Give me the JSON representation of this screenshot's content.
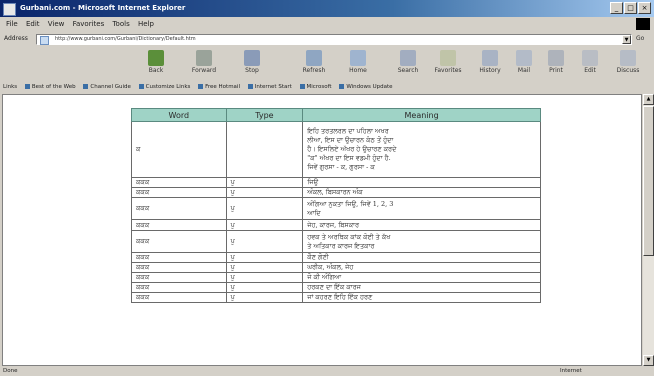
{
  "window": {
    "title": "Gurbani.com - Microsoft Internet Explorer",
    "title_color": "#0a246a"
  },
  "menu": [
    "File",
    "Edit",
    "View",
    "Favorites",
    "Tools",
    "Help"
  ],
  "address": {
    "label": "Address",
    "url": "http://www.gurbani.com/Gurbani/Dictionary/Default.htm",
    "go_label": "Go"
  },
  "toolbar": {
    "buttons": [
      {
        "label": "Back",
        "icon": "back-arrow-icon",
        "color": "#5b8f3a"
      },
      {
        "label": "Forward",
        "icon": "forward-arrow-icon",
        "color": "#9aa39a"
      },
      {
        "label": "Stop",
        "icon": "stop-icon",
        "color": "#8a9bb8"
      },
      {
        "label": "Refresh",
        "icon": "refresh-icon",
        "color": "#8fa6c2"
      },
      {
        "label": "Home",
        "icon": "home-icon",
        "color": "#9fb4cf"
      },
      {
        "label": "Search",
        "icon": "search-icon",
        "color": "#a2adc0"
      },
      {
        "label": "Favorites",
        "icon": "favorites-icon",
        "color": "#c0c4a8"
      },
      {
        "label": "History",
        "icon": "history-icon",
        "color": "#a9b3c4"
      },
      {
        "label": "Mail",
        "icon": "mail-icon",
        "color": "#b3bbc8"
      },
      {
        "label": "Print",
        "icon": "print-icon",
        "color": "#aeb3bb"
      },
      {
        "label": "Edit",
        "icon": "edit-icon",
        "color": "#b9bdc4"
      },
      {
        "label": "Discuss",
        "icon": "discuss-icon",
        "color": "#b6bcc6"
      }
    ]
  },
  "links": {
    "label": "Links",
    "items": [
      "Best of the Web",
      "Channel Guide",
      "Customize Links",
      "Free Hotmail",
      "Internet Start",
      "Microsoft",
      "Windows Update"
    ]
  },
  "table": {
    "headers": {
      "word": "Word",
      "type": "Type",
      "meaning": "Meaning"
    },
    "rows": [
      {
        "word": "ਕ",
        "type": "",
        "meaning": [
          "ਇਹਿ ਤਰਤਲਰਲ ਦਾ ਪਹਿਲਾ ਅਖਰ",
          "ਲੀਆ, ਇਸ ਦਾ ਉਚਾਰਨ ਕੰਠ ਤੋਂ ਹੁੰਦਾ",
          "ਹੈ। ਇਸਲਿਏ ਅੱਖਰ ਹੇ ਉਚਾਰਣ ਕਰਦੇ",
          "\"ਕ\" ਅੱਖਰ ਦਾ ਇਸ ਵਡਮੀ ਹੁੰਦਾ ਹੈ.",
          "ਜਿਵੇਂ ਗੁਰਸਾ - ਕ, ਗੁਰਸਾ - ਕ"
        ]
      },
      {
        "word": "ਕਕਕ",
        "type": "ਪੁ",
        "meaning": [
          "ਜਿਉ"
        ]
      },
      {
        "word": "ਕਕਕ",
        "type": "ਪੁ",
        "meaning": [
          "ਅੰਕਲ, ਬਿਸਕਾਰਨ ਅੰਕ"
        ]
      },
      {
        "word": "ਕਕਕ",
        "type": "ਪੁ",
        "meaning": [
          "ਅੰਗਿਆ ਨੁਕਤਾ ਜਿਉ, ਜਿਵੇਂ 1, 2, 3",
          "ਆਦਿ"
        ]
      },
      {
        "word": "ਕਕਕ",
        "type": "ਪੁ",
        "meaning": [
          "ਜੇਹ, ਕਾਰਜ, ਬਿਸਕਾਰ"
        ]
      },
      {
        "word": "ਕਕਕ",
        "type": "ਪੁ",
        "meaning": [
          "ਹਵਕ ਤੇ ਅਰਥਿਕ ਕਾਂਕ ਕੋਈ ਤੇ ਕੱਖ",
          "ਤੇ ਅਤਿਕਾਰ ਕਾਰਜ ਇਤਕਾਰ"
        ]
      },
      {
        "word": "ਕਕਕ",
        "type": "ਪੁ",
        "meaning": [
          "ਕੌਣ ਗੋਣੀ"
        ]
      },
      {
        "word": "ਕਕਕ",
        "type": "ਪੁ",
        "meaning": [
          "ਘਰੀਕ, ਅੰਕਲ, ਜੇਹ"
        ]
      },
      {
        "word": "ਕਕਕ",
        "type": "ਪੁ",
        "meaning": [
          "ਜੋ ਕੀ ਅੰਗਿਆ"
        ]
      },
      {
        "word": "ਕਕਕ",
        "type": "ਪੁ",
        "meaning": [
          "ਹਰਕਣ ਦਾ ਇੱਕ ਕਾਰਜ"
        ]
      },
      {
        "word": "ਕਕਕ",
        "type": "ਪੁ",
        "meaning": [
          "ਜਾਂ ਕਹਰਣ ਇਹਿ ਇੱਕ ਹਰਣ"
        ]
      }
    ]
  },
  "status": {
    "text": "Done",
    "zone": "Internet"
  }
}
